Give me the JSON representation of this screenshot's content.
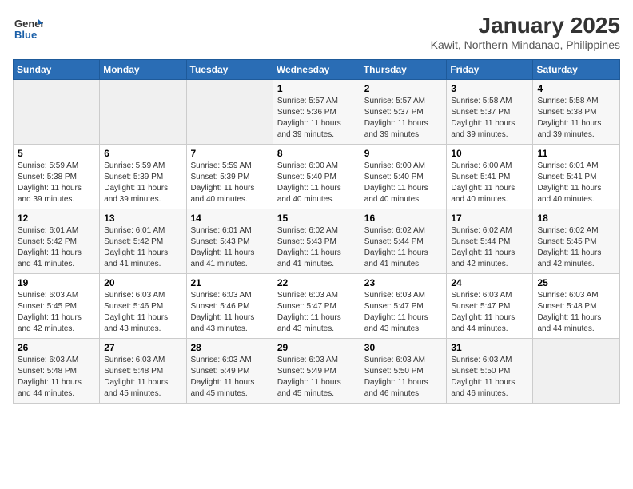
{
  "logo": {
    "line1": "General",
    "line2": "Blue"
  },
  "title": "January 2025",
  "subtitle": "Kawit, Northern Mindanao, Philippines",
  "weekdays": [
    "Sunday",
    "Monday",
    "Tuesday",
    "Wednesday",
    "Thursday",
    "Friday",
    "Saturday"
  ],
  "weeks": [
    [
      {
        "day": "",
        "info": ""
      },
      {
        "day": "",
        "info": ""
      },
      {
        "day": "",
        "info": ""
      },
      {
        "day": "1",
        "info": "Sunrise: 5:57 AM\nSunset: 5:36 PM\nDaylight: 11 hours\nand 39 minutes."
      },
      {
        "day": "2",
        "info": "Sunrise: 5:57 AM\nSunset: 5:37 PM\nDaylight: 11 hours\nand 39 minutes."
      },
      {
        "day": "3",
        "info": "Sunrise: 5:58 AM\nSunset: 5:37 PM\nDaylight: 11 hours\nand 39 minutes."
      },
      {
        "day": "4",
        "info": "Sunrise: 5:58 AM\nSunset: 5:38 PM\nDaylight: 11 hours\nand 39 minutes."
      }
    ],
    [
      {
        "day": "5",
        "info": "Sunrise: 5:59 AM\nSunset: 5:38 PM\nDaylight: 11 hours\nand 39 minutes."
      },
      {
        "day": "6",
        "info": "Sunrise: 5:59 AM\nSunset: 5:39 PM\nDaylight: 11 hours\nand 39 minutes."
      },
      {
        "day": "7",
        "info": "Sunrise: 5:59 AM\nSunset: 5:39 PM\nDaylight: 11 hours\nand 40 minutes."
      },
      {
        "day": "8",
        "info": "Sunrise: 6:00 AM\nSunset: 5:40 PM\nDaylight: 11 hours\nand 40 minutes."
      },
      {
        "day": "9",
        "info": "Sunrise: 6:00 AM\nSunset: 5:40 PM\nDaylight: 11 hours\nand 40 minutes."
      },
      {
        "day": "10",
        "info": "Sunrise: 6:00 AM\nSunset: 5:41 PM\nDaylight: 11 hours\nand 40 minutes."
      },
      {
        "day": "11",
        "info": "Sunrise: 6:01 AM\nSunset: 5:41 PM\nDaylight: 11 hours\nand 40 minutes."
      }
    ],
    [
      {
        "day": "12",
        "info": "Sunrise: 6:01 AM\nSunset: 5:42 PM\nDaylight: 11 hours\nand 41 minutes."
      },
      {
        "day": "13",
        "info": "Sunrise: 6:01 AM\nSunset: 5:42 PM\nDaylight: 11 hours\nand 41 minutes."
      },
      {
        "day": "14",
        "info": "Sunrise: 6:01 AM\nSunset: 5:43 PM\nDaylight: 11 hours\nand 41 minutes."
      },
      {
        "day": "15",
        "info": "Sunrise: 6:02 AM\nSunset: 5:43 PM\nDaylight: 11 hours\nand 41 minutes."
      },
      {
        "day": "16",
        "info": "Sunrise: 6:02 AM\nSunset: 5:44 PM\nDaylight: 11 hours\nand 41 minutes."
      },
      {
        "day": "17",
        "info": "Sunrise: 6:02 AM\nSunset: 5:44 PM\nDaylight: 11 hours\nand 42 minutes."
      },
      {
        "day": "18",
        "info": "Sunrise: 6:02 AM\nSunset: 5:45 PM\nDaylight: 11 hours\nand 42 minutes."
      }
    ],
    [
      {
        "day": "19",
        "info": "Sunrise: 6:03 AM\nSunset: 5:45 PM\nDaylight: 11 hours\nand 42 minutes."
      },
      {
        "day": "20",
        "info": "Sunrise: 6:03 AM\nSunset: 5:46 PM\nDaylight: 11 hours\nand 43 minutes."
      },
      {
        "day": "21",
        "info": "Sunrise: 6:03 AM\nSunset: 5:46 PM\nDaylight: 11 hours\nand 43 minutes."
      },
      {
        "day": "22",
        "info": "Sunrise: 6:03 AM\nSunset: 5:47 PM\nDaylight: 11 hours\nand 43 minutes."
      },
      {
        "day": "23",
        "info": "Sunrise: 6:03 AM\nSunset: 5:47 PM\nDaylight: 11 hours\nand 43 minutes."
      },
      {
        "day": "24",
        "info": "Sunrise: 6:03 AM\nSunset: 5:47 PM\nDaylight: 11 hours\nand 44 minutes."
      },
      {
        "day": "25",
        "info": "Sunrise: 6:03 AM\nSunset: 5:48 PM\nDaylight: 11 hours\nand 44 minutes."
      }
    ],
    [
      {
        "day": "26",
        "info": "Sunrise: 6:03 AM\nSunset: 5:48 PM\nDaylight: 11 hours\nand 44 minutes."
      },
      {
        "day": "27",
        "info": "Sunrise: 6:03 AM\nSunset: 5:48 PM\nDaylight: 11 hours\nand 45 minutes."
      },
      {
        "day": "28",
        "info": "Sunrise: 6:03 AM\nSunset: 5:49 PM\nDaylight: 11 hours\nand 45 minutes."
      },
      {
        "day": "29",
        "info": "Sunrise: 6:03 AM\nSunset: 5:49 PM\nDaylight: 11 hours\nand 45 minutes."
      },
      {
        "day": "30",
        "info": "Sunrise: 6:03 AM\nSunset: 5:50 PM\nDaylight: 11 hours\nand 46 minutes."
      },
      {
        "day": "31",
        "info": "Sunrise: 6:03 AM\nSunset: 5:50 PM\nDaylight: 11 hours\nand 46 minutes."
      },
      {
        "day": "",
        "info": ""
      }
    ]
  ]
}
